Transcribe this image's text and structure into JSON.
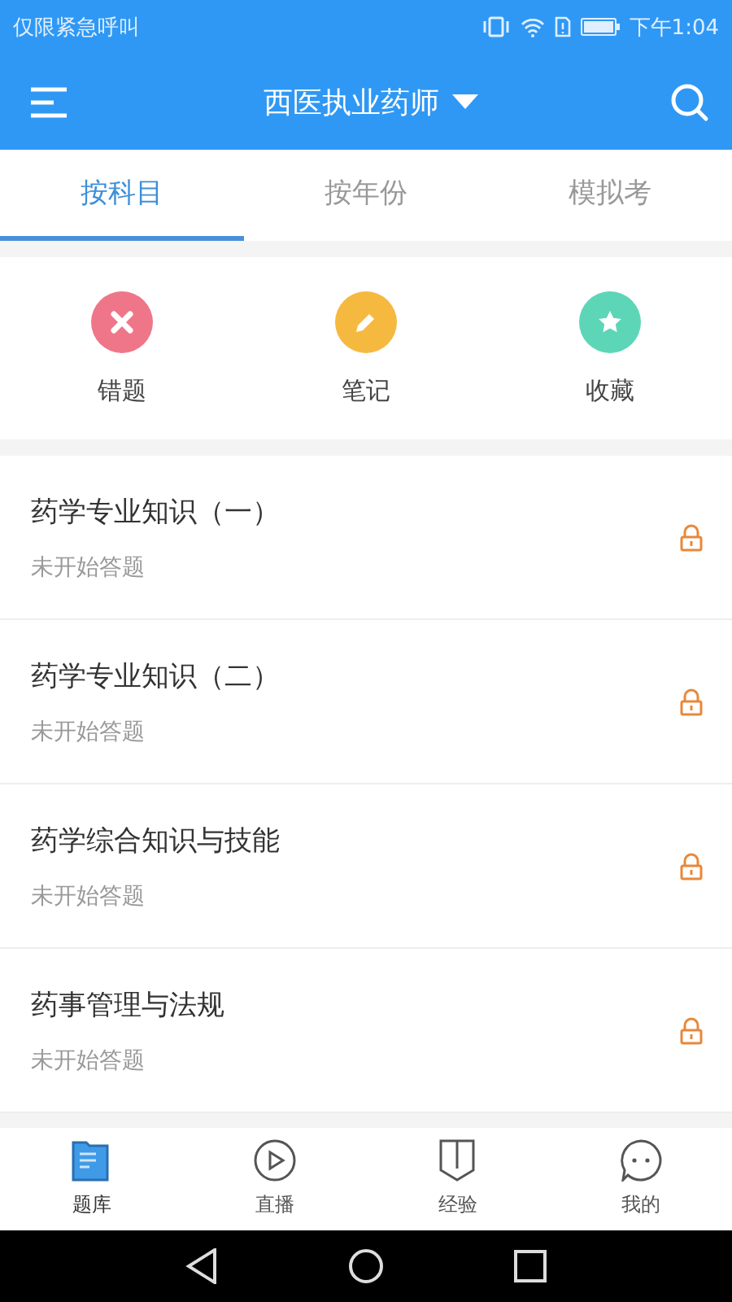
{
  "status_bar": {
    "carrier": "仅限紧急呼叫",
    "time": "下午1:04"
  },
  "app_bar": {
    "title": "西医执业药师"
  },
  "tabs": [
    {
      "label": "按科目",
      "selected": true
    },
    {
      "label": "按年份",
      "selected": false
    },
    {
      "label": "模拟考",
      "selected": false
    }
  ],
  "shortcuts": [
    {
      "label": "错题",
      "kind": "wrong",
      "color": "#ef7689"
    },
    {
      "label": "笔记",
      "kind": "note",
      "color": "#f6b940"
    },
    {
      "label": "收藏",
      "kind": "favorite",
      "color": "#5dd6b8"
    }
  ],
  "subjects": [
    {
      "title": "药学专业知识（一）",
      "status": "未开始答题",
      "locked": true
    },
    {
      "title": "药学专业知识（二）",
      "status": "未开始答题",
      "locked": true
    },
    {
      "title": "药学综合知识与技能",
      "status": "未开始答题",
      "locked": true
    },
    {
      "title": "药事管理与法规",
      "status": "未开始答题",
      "locked": true
    }
  ],
  "bottom_nav": [
    {
      "label": "题库",
      "kind": "bank",
      "selected": true
    },
    {
      "label": "直播",
      "kind": "live",
      "selected": false
    },
    {
      "label": "经验",
      "kind": "experience",
      "selected": false
    },
    {
      "label": "我的",
      "kind": "me",
      "selected": false
    }
  ]
}
